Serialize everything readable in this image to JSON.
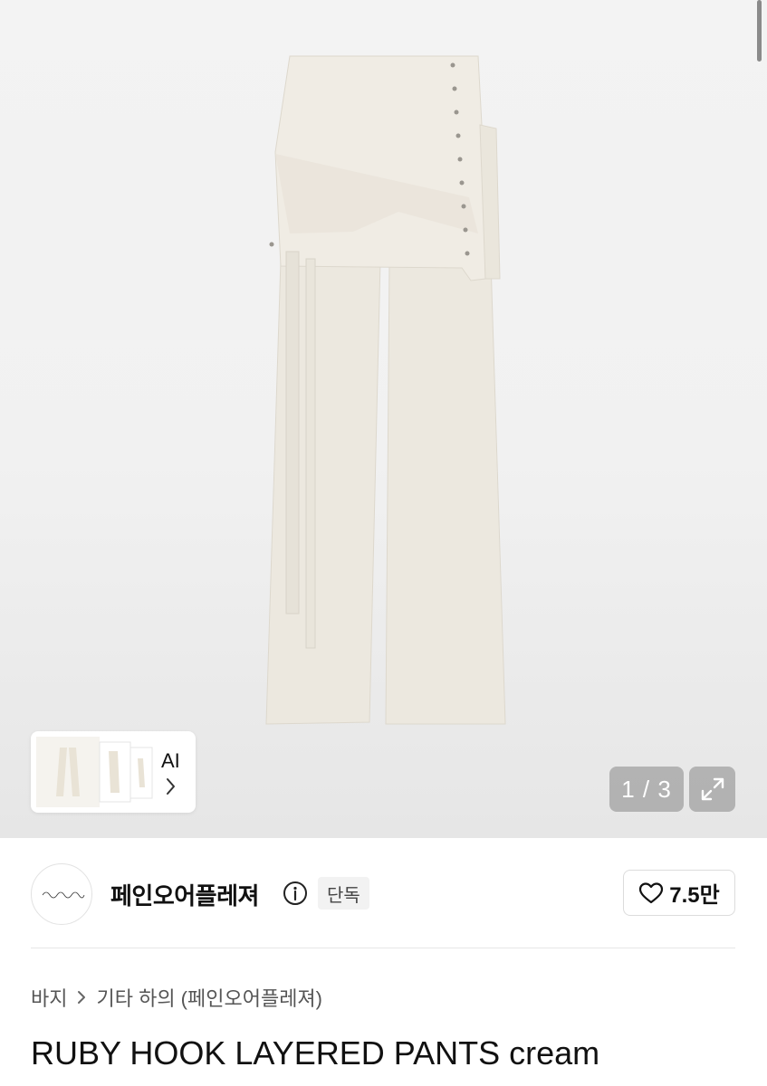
{
  "gallery": {
    "current": "1",
    "separator": "/",
    "total": "3",
    "counter_text": "1 / 3",
    "ai_label": "AI",
    "icons": {
      "expand": "expand-arrows-icon",
      "chevron": "chevron-right-icon"
    }
  },
  "shop": {
    "name": "페인오어플레져",
    "badge": "단독",
    "likes": "7.5만",
    "icons": {
      "info": "info-circle-icon",
      "like": "heart-outline-icon"
    }
  },
  "breadcrumb": {
    "items": [
      "바지",
      "기타 하의 (페인오어플레져)"
    ],
    "separator_icon": "chevron-right-icon"
  },
  "product": {
    "title": "RUBY HOOK LAYERED PANTS cream"
  },
  "colors": {
    "garment": "#eeeae2",
    "hero_bg": "#f1f1f1",
    "overlay": "#8a8a8a"
  }
}
